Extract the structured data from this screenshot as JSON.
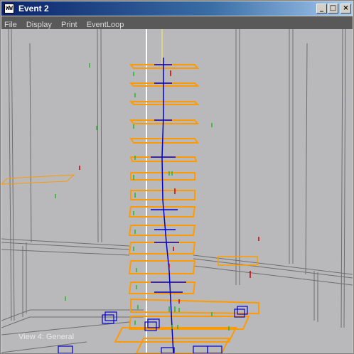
{
  "window": {
    "title": "Event 2",
    "app_icon_text": "WW",
    "controls": {
      "minimize": "_",
      "maximize": "□",
      "close": "×"
    }
  },
  "menu": {
    "items": [
      {
        "label": "File"
      },
      {
        "label": "Display"
      },
      {
        "label": "Print"
      },
      {
        "label": "EventLoop"
      }
    ]
  },
  "viewport": {
    "view_label": "View 4: General",
    "colors": {
      "background": "#b9b9bc",
      "detector_lines": "#6e6e6e",
      "tracking_planes": "#ff9a00",
      "track": "#0000cc",
      "beam_line": "#ffffff",
      "hits_green": "#22bb22",
      "hits_red": "#cc0000"
    }
  }
}
